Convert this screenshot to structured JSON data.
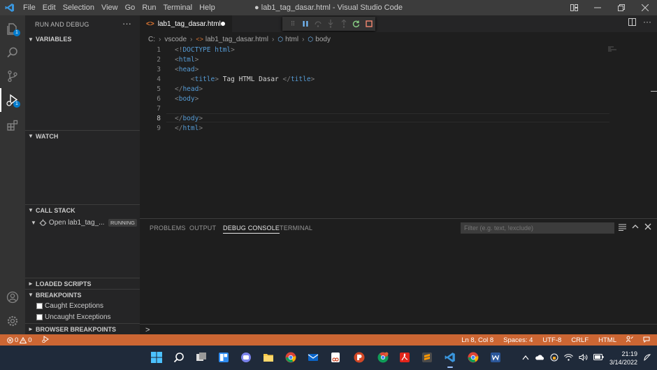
{
  "window": {
    "title": "● lab1_tag_dasar.html - Visual Studio Code",
    "menu": [
      "File",
      "Edit",
      "Selection",
      "View",
      "Go",
      "Run",
      "Terminal",
      "Help"
    ]
  },
  "activity": {
    "explorer_badge": "1",
    "debug_badge": "1"
  },
  "sidebar": {
    "header": "RUN AND DEBUG",
    "variables": "VARIABLES",
    "watch": "WATCH",
    "call_stack": "CALL STACK",
    "call_stack_item": "Open lab1_tag_...",
    "call_stack_status": "RUNNING",
    "loaded_scripts": "LOADED SCRIPTS",
    "breakpoints": "BREAKPOINTS",
    "bp_caught": "Caught Exceptions",
    "bp_uncaught": "Uncaught Exceptions",
    "browser_breakpoints": "BROWSER BREAKPOINTS"
  },
  "editor": {
    "tab_label": "lab1_tag_dasar.html",
    "breadcrumb": [
      "C:",
      "vscode",
      "lab1_tag_dasar.html",
      "html",
      "body"
    ],
    "lines": [
      {
        "n": "1",
        "parts": [
          [
            "tg",
            "<!"
          ],
          [
            "dt",
            "DOCTYPE"
          ],
          [
            "tx",
            " "
          ],
          [
            "tn",
            "html"
          ],
          [
            "tg",
            ">"
          ]
        ]
      },
      {
        "n": "2",
        "parts": [
          [
            "tg",
            "<"
          ],
          [
            "tn",
            "html"
          ],
          [
            "tg",
            ">"
          ]
        ]
      },
      {
        "n": "3",
        "parts": [
          [
            "tg",
            "<"
          ],
          [
            "tn",
            "head"
          ],
          [
            "tg",
            ">"
          ]
        ]
      },
      {
        "n": "4",
        "parts": [
          [
            "tx",
            "    "
          ],
          [
            "tg",
            "<"
          ],
          [
            "tn",
            "title"
          ],
          [
            "tg",
            ">"
          ],
          [
            "tx",
            " Tag HTML Dasar "
          ],
          [
            "tg",
            "</"
          ],
          [
            "tn",
            "title"
          ],
          [
            "tg",
            ">"
          ]
        ]
      },
      {
        "n": "5",
        "parts": [
          [
            "tg",
            "</"
          ],
          [
            "tn",
            "head"
          ],
          [
            "tg",
            ">"
          ]
        ]
      },
      {
        "n": "6",
        "parts": [
          [
            "tg",
            "<"
          ],
          [
            "tn",
            "body"
          ],
          [
            "tg",
            ">"
          ]
        ]
      },
      {
        "n": "7",
        "parts": []
      },
      {
        "n": "8",
        "parts": [
          [
            "tg",
            "</"
          ],
          [
            "tn",
            "body"
          ],
          [
            "tg",
            ">"
          ]
        ]
      },
      {
        "n": "9",
        "parts": [
          [
            "tg",
            "</"
          ],
          [
            "tn",
            "html"
          ],
          [
            "tg",
            ">"
          ]
        ]
      }
    ],
    "current_line": "8"
  },
  "panel": {
    "tabs": [
      "PROBLEMS",
      "OUTPUT",
      "DEBUG CONSOLE",
      "TERMINAL"
    ],
    "active_tab": "DEBUG CONSOLE",
    "filter_placeholder": "Filter (e.g. text, !exclude)",
    "prompt": ">"
  },
  "status": {
    "errors": "0",
    "warnings": "0",
    "position": "Ln 8, Col 8",
    "spaces": "Spaces: 4",
    "encoding": "UTF-8",
    "eol": "CRLF",
    "language": "HTML"
  },
  "taskbar": {
    "time": "21:19",
    "date": "3/14/2022"
  },
  "colors": {
    "status_bar": "#cc6633",
    "accent": "#007acc"
  }
}
